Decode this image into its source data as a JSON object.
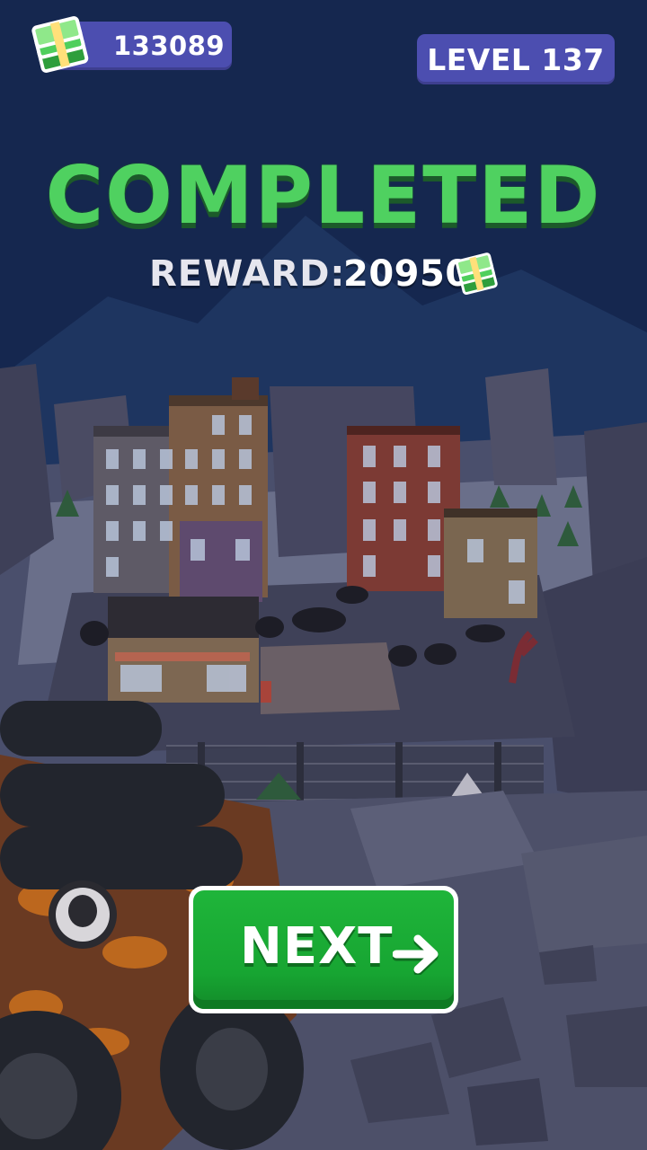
{
  "hud": {
    "currency_amount": "133089",
    "level_label": "LEVEL 137"
  },
  "result": {
    "title": "COMPLETED",
    "reward_label": "REWARD:",
    "reward_amount": "20950"
  },
  "actions": {
    "next_label": "NEXT"
  },
  "icons": {
    "currency": "cash-stack-icon",
    "next": "arrow-right-icon"
  },
  "colors": {
    "sky": "#15274f",
    "hud_panel": "#4c4eb0",
    "title_green": "#4fd160",
    "button_green": "#17a532"
  }
}
